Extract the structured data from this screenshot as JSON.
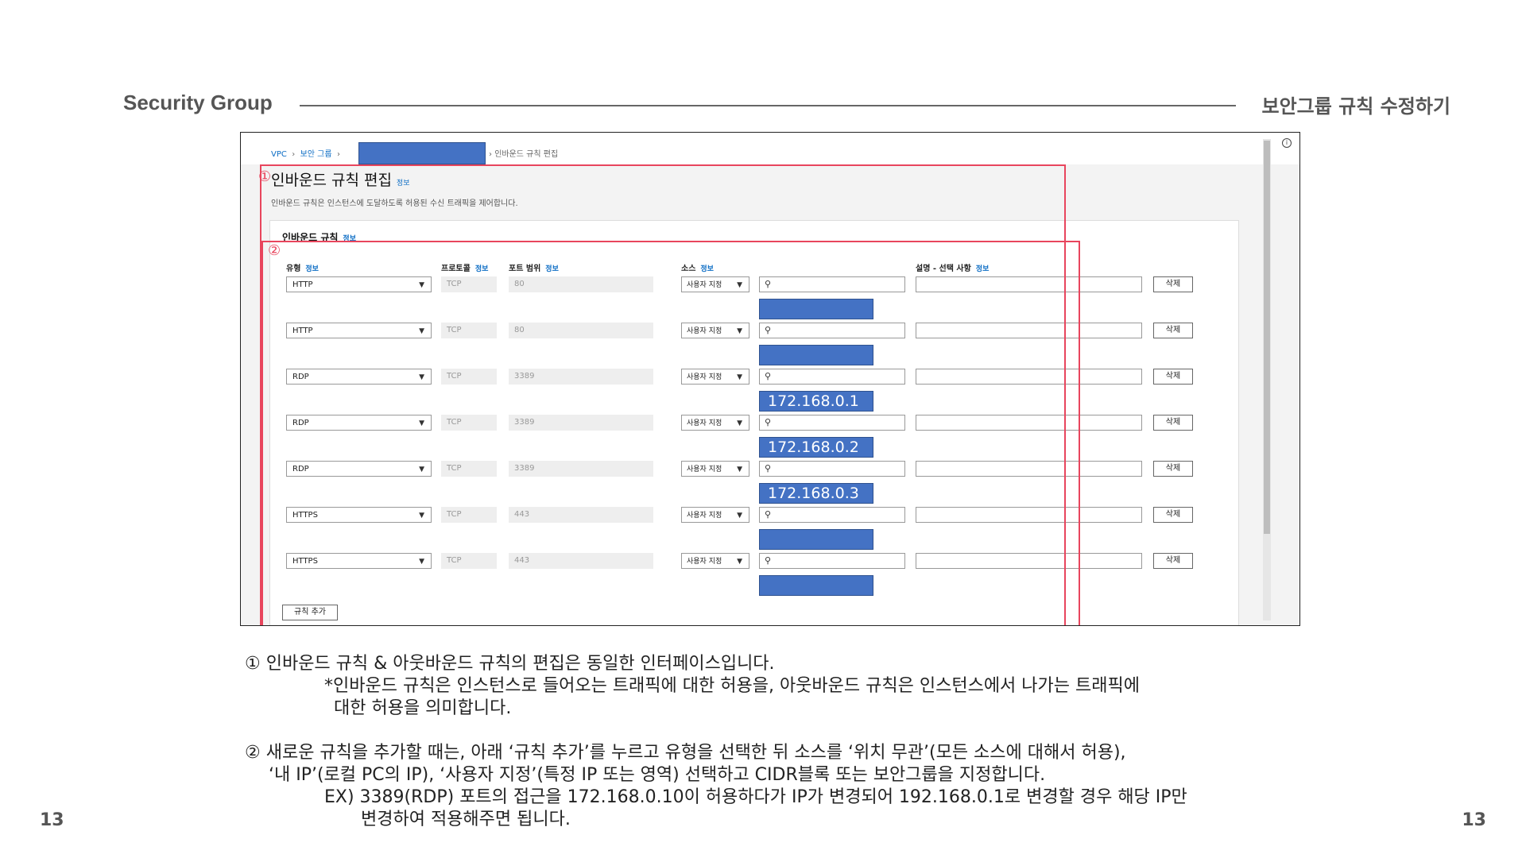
{
  "slide": {
    "header_left": "Security Group",
    "header_right": "보안그룹 규칙 수정하기",
    "page_number": "13"
  },
  "screen": {
    "breadcrumbs": [
      "VPC",
      "보안 그룹"
    ],
    "breadcrumb_current": "인바운드 규칙 편집",
    "title": "인바운드 규칙 편집",
    "info_label": "정보",
    "description": "인바운드 규칙은 인스턴스에 도달하도록 허용된 수신 트래픽을 제어합니다.",
    "panel_title": "인바운드 규칙",
    "columns": {
      "type": "유형",
      "protocol": "프로토콜",
      "port_range": "포트 범위",
      "source": "소스",
      "description": "설명 - 선택 사항"
    },
    "rules": [
      {
        "type": "HTTP",
        "protocol": "TCP",
        "port": "80",
        "source_type": "사용자 지정",
        "cidr_label": ""
      },
      {
        "type": "HTTP",
        "protocol": "TCP",
        "port": "80",
        "source_type": "사용자 지정",
        "cidr_label": ""
      },
      {
        "type": "RDP",
        "protocol": "TCP",
        "port": "3389",
        "source_type": "사용자 지정",
        "cidr_label": "172.168.0.1"
      },
      {
        "type": "RDP",
        "protocol": "TCP",
        "port": "3389",
        "source_type": "사용자 지정",
        "cidr_label": "172.168.0.2"
      },
      {
        "type": "RDP",
        "protocol": "TCP",
        "port": "3389",
        "source_type": "사용자 지정",
        "cidr_label": "172.168.0.3"
      },
      {
        "type": "HTTPS",
        "protocol": "TCP",
        "port": "443",
        "source_type": "사용자 지정",
        "cidr_label": ""
      },
      {
        "type": "HTTPS",
        "protocol": "TCP",
        "port": "443",
        "source_type": "사용자 지정",
        "cidr_label": ""
      }
    ],
    "delete_label": "삭제",
    "add_rule_label": "규칙 추가",
    "markers": [
      "①",
      "②"
    ]
  },
  "notes": {
    "line1": "① 인바운드 규칙 & 아웃바운드 규칙의 편집은 동일한 인터페이스입니다.",
    "line2": "*인바운드 규칙은 인스턴스로 들어오는 트래픽에 대한 허용을, 아웃바운드 규칙은 인스턴스에서 나가는 트래픽에",
    "line3": "대한 허용을 의미합니다.",
    "line4": "② 새로운 규칙을 추가할 때는, 아래 ‘규칙 추가’를 누르고 유형을 선택한 뒤 소스를 ‘위치 무관’(모든 소스에 대해서 허용),",
    "line5": "‘내 IP’(로컬 PC의 IP), ‘사용자 지정’(특정 IP 또는 영역) 선택하고 CIDR블록 또는 보안그룹을 지정합니다.",
    "line6": "EX) 3389(RDP) 포트의 접근을 172.168.0.10이 허용하다가 IP가 변경되어 192.168.0.1로 변경할 경우 해당 IP만",
    "line7": "변경하여 적용해주면 됩니다."
  },
  "colors": {
    "highlight_red": "#e8455d",
    "mask_blue": "#4472c4",
    "link_blue": "#0b6cc4"
  }
}
